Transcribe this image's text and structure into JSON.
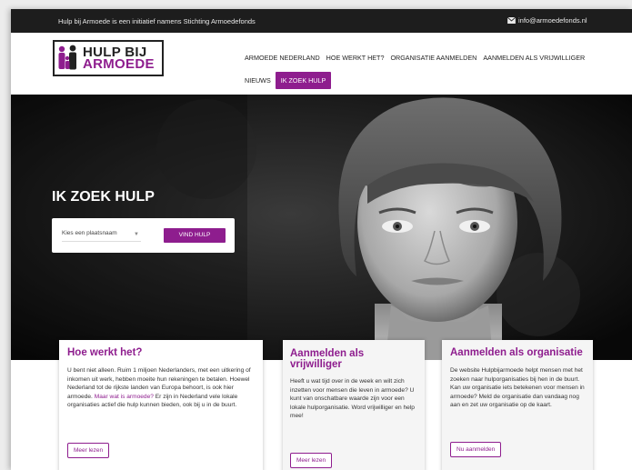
{
  "topbar": {
    "tagline": "Hulp bij Armoede is een initiatief namens Stichting Armoedefonds",
    "email": "info@armoedefonds.nl"
  },
  "logo": {
    "line1": "HULP BIJ",
    "line2": "ARMOEDE"
  },
  "nav": {
    "items": [
      "ARMOEDE NEDERLAND",
      "HOE WERKT HET?",
      "ORGANISATIE AANMELDEN",
      "AANMELDEN ALS VRIJWILLIGER"
    ],
    "news": "NIEUWS",
    "active": "IK ZOEK HULP"
  },
  "hero": {
    "title": "IK ZOEK HULP",
    "select_value": "Kies een plaatsnaam",
    "submit": "VIND HULP"
  },
  "cards": [
    {
      "title": "Hoe werkt het?",
      "text": "U bent niet alleen. Ruim 1 miljoen Nederlanders, met een uitkering of inkomen uit werk, hebben moeite hun rekeningen te betalen. Hoewel Nederland tot de rijkste landen van Europa behoort, is ook hier armoede. ",
      "link": "Maar wat is armoede?",
      "text2": " Er zijn in Nederland vele lokale organisaties actief die hulp kunnen bieden, ook bij u in de buurt.",
      "button": "Meer lezen"
    },
    {
      "title": "Aanmelden als vrijwilliger",
      "text": "Heeft u wat tijd over in de week en wilt zich inzetten voor mensen die leven in armoede? U kunt van onschatbare waarde zijn voor een lokale hulporganisatie. Word vrijwilliger en help mee!",
      "button": "Meer lezen"
    },
    {
      "title": "Aanmelden als organisatie",
      "text": "De website Hulpbijarmoede helpt mensen met het zoeken naar hulporganisaties bij hen in de buurt. Kan uw organisatie iets betekenen voor mensen in armoede? Meld de organisatie dan vandaag nog aan en zet uw organisatie op de kaart.",
      "button": "Nu aanmelden"
    }
  ],
  "colors": {
    "brand": "#8e1d8e",
    "topbar": "#1d1d1d"
  }
}
